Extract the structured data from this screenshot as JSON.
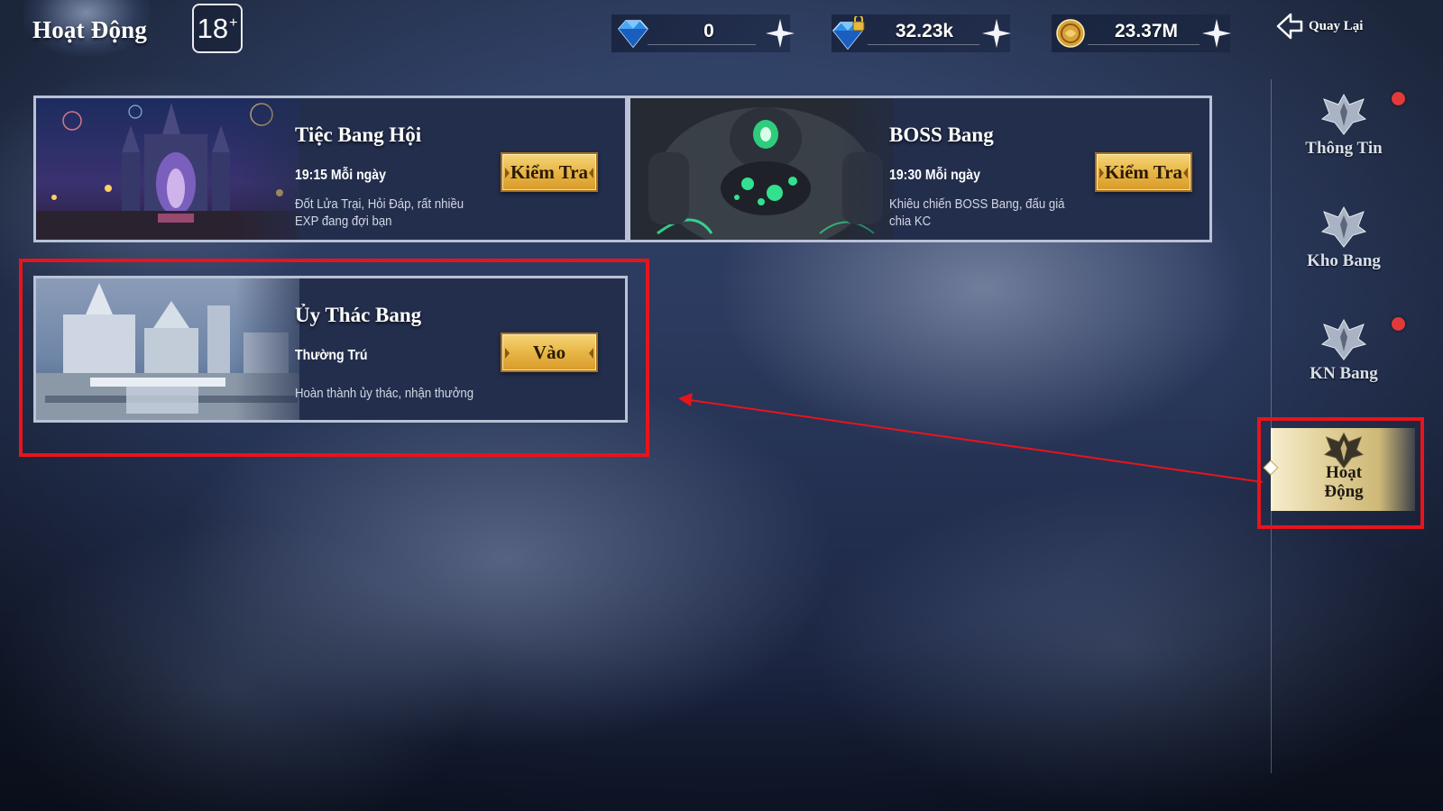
{
  "header": {
    "title": "Hoạt Động",
    "age_rating": "18",
    "age_rating_suffix": "+",
    "back_label": "Quay Lại"
  },
  "currencies": [
    {
      "name": "diamond",
      "icon": "blue-diamond-icon",
      "value": "0"
    },
    {
      "name": "bound-diamond",
      "icon": "locked-diamond-icon",
      "value": "32.23k"
    },
    {
      "name": "gold",
      "icon": "gold-coin-icon",
      "value": "23.37M"
    }
  ],
  "activities": [
    {
      "title": "Tiệc Bang Hội",
      "time": "19:15 Mỗi ngày",
      "description": "Đốt Lửa Trại, Hỏi Đáp, rất nhiều EXP đang đợi bạn",
      "action": "Kiểm Tra",
      "art": "castle-festival"
    },
    {
      "title": "BOSS Bang",
      "time": "19:30 Mỗi ngày",
      "description": "Khiêu chiến BOSS Bang, đấu giá chia KC",
      "action": "Kiểm Tra",
      "art": "green-golem-boss"
    },
    {
      "title": "Ủy Thác Bang",
      "time": "Thường Trú",
      "description": "Hoàn thành ủy thác, nhận thưởng",
      "action": "Vào",
      "art": "white-city"
    }
  ],
  "sidebar": {
    "items": [
      {
        "label": "Thông Tin",
        "notification": true
      },
      {
        "label": "Kho Bang",
        "notification": false
      },
      {
        "label": "KN Bang",
        "notification": true
      }
    ],
    "active": {
      "label_line1": "Hoạt",
      "label_line2": "Động"
    }
  },
  "colors": {
    "highlight": "#e8141c",
    "button_gold": "#e9b94a",
    "card_bg": "#232e4d",
    "notification": "#e23a3a"
  }
}
